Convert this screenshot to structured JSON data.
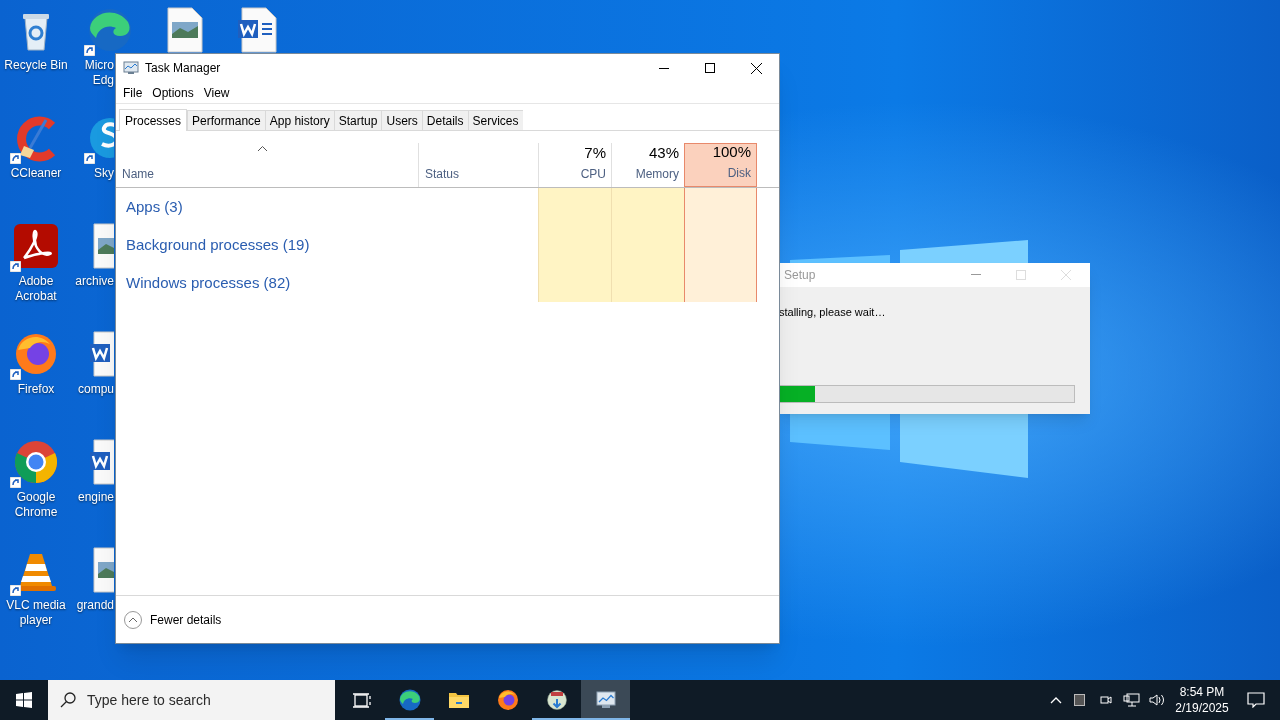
{
  "desktop": {
    "columns": [
      [
        {
          "label": "Recycle Bin",
          "kind": "bin",
          "shortcut": false
        },
        {
          "label": "CCleaner",
          "kind": "cleaner",
          "shortcut": true
        },
        {
          "label": "Adobe Acrobat",
          "kind": "pdf",
          "shortcut": true
        },
        {
          "label": "Firefox",
          "kind": "firefox",
          "shortcut": true
        },
        {
          "label": "Google Chrome",
          "kind": "chrome",
          "shortcut": true
        },
        {
          "label": "VLC media player",
          "kind": "cone",
          "shortcut": true
        }
      ],
      [
        {
          "label": "Micro Edg",
          "kind": "edge",
          "shortcut": true
        },
        {
          "label": "Sky",
          "kind": "chat",
          "shortcut": true
        },
        {
          "label": "archive",
          "kind": "image",
          "shortcut": false
        },
        {
          "label": "compu",
          "kind": "doc",
          "shortcut": false
        },
        {
          "label": "engine",
          "kind": "doc",
          "shortcut": false
        },
        {
          "label": "grandd",
          "kind": "image",
          "shortcut": false
        }
      ],
      [
        {
          "kind": "image",
          "shortcut": false
        }
      ],
      [
        {
          "kind": "doc",
          "shortcut": false
        }
      ]
    ]
  },
  "setup_window": {
    "title": "Setup",
    "message": "stalling, please wait…",
    "progress": {
      "level": 0.12
    }
  },
  "task_manager": {
    "title": "Task Manager",
    "menu": [
      "File",
      "Options",
      "View"
    ],
    "tabs": [
      {
        "label": "Processes",
        "selected": true
      },
      {
        "label": "Performance",
        "selected": false
      },
      {
        "label": "App history",
        "selected": false
      },
      {
        "label": "Startup",
        "selected": false
      },
      {
        "label": "Users",
        "selected": false
      },
      {
        "label": "Details",
        "selected": false
      },
      {
        "label": "Services",
        "selected": false
      }
    ],
    "columns": [
      {
        "kind": "name",
        "label": "Name",
        "sorted": true
      },
      {
        "kind": "status",
        "label": "Status",
        "sorted": false
      },
      {
        "kind": "metric",
        "value": "7%",
        "label": "CPU",
        "highlighted": false
      },
      {
        "kind": "metric",
        "value": "43%",
        "label": "Memory",
        "highlighted": false
      },
      {
        "kind": "metric",
        "value": "100%",
        "label": "Disk",
        "highlighted": true
      }
    ],
    "groups": [
      "Apps (3)",
      "Background processes (19)",
      "Windows processes (82)"
    ],
    "footer": "Fewer details"
  },
  "taskbar": {
    "search_placeholder": "Type here to search",
    "apps": [
      {
        "kind": "task_view",
        "open": false,
        "selected": false
      },
      {
        "kind": "edge",
        "open": true,
        "selected": false
      },
      {
        "kind": "folder",
        "open": false,
        "selected": false
      },
      {
        "kind": "firefox",
        "open": false,
        "selected": false
      },
      {
        "kind": "installer",
        "open": true,
        "selected": false
      },
      {
        "kind": "task_manager",
        "open": true,
        "selected": true
      }
    ],
    "clock": {
      "time": "8:54 PM",
      "date": "2/19/2025"
    }
  }
}
